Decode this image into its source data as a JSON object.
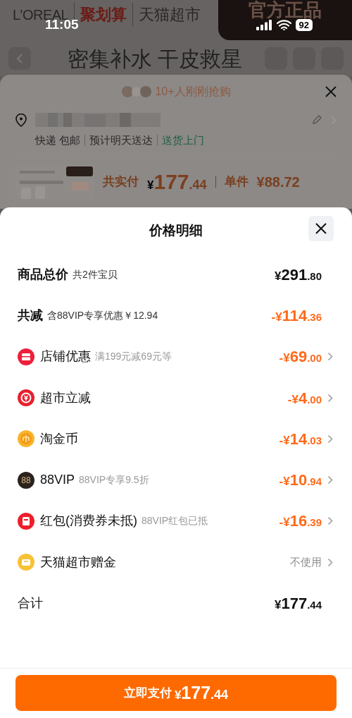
{
  "status_bar": {
    "time": "11:05",
    "battery": "92"
  },
  "banner": {
    "brand": "L'OREAL",
    "promo": "聚划算",
    "store": "天猫超市",
    "badge": "官方正品"
  },
  "page_title": "密集补水 干皮救星",
  "order_sheet": {
    "buyers": "10+人刚刚抢购",
    "shipping": [
      "快递 包邮",
      "预计明天送达"
    ],
    "delivery": "送货上门",
    "total_label": "共实付",
    "total": "¥177.44",
    "unit_label": "单件",
    "unit": "¥88.72"
  },
  "price_detail": {
    "title": "价格明细",
    "rows": [
      {
        "kind": "plain",
        "label": "商品总价",
        "bold": true,
        "note": "共2件宝贝",
        "amount": "¥291.80",
        "color": "#111111",
        "chevron": false
      },
      {
        "kind": "plain",
        "label": "共减",
        "bold": true,
        "note": "含88VIP专享优惠￥12.94",
        "amount": "-¥114.36",
        "color": "#ff6a1a",
        "chevron": false
      },
      {
        "kind": "shop",
        "label": "店铺优惠",
        "bold": false,
        "note": "满199元减69元等",
        "amount": "-¥69.00",
        "color": "#ff6a1a",
        "chevron": true
      },
      {
        "kind": "cut",
        "label": "超市立减",
        "bold": false,
        "amount": "-¥4.00",
        "color": "#ff6a1a",
        "chevron": true
      },
      {
        "kind": "coin",
        "label": "淘金币",
        "bold": false,
        "amount": "-¥14.03",
        "color": "#ff6a1a",
        "chevron": true
      },
      {
        "kind": "vip",
        "icon_label": "88",
        "label": "88VIP",
        "bold": false,
        "note": "88VIP专享9.5折",
        "amount": "-¥10.94",
        "color": "#ff6a1a",
        "chevron": true
      },
      {
        "kind": "packet",
        "label": "红包(消费券未抵)",
        "bold": false,
        "note": "88VIP红包已抵",
        "amount": "-¥16.39",
        "color": "#ff6a1a",
        "chevron": true
      },
      {
        "kind": "gift",
        "label": "天猫超市赠金",
        "bold": false,
        "amount": "不使用",
        "color": "#8b8b8b",
        "chevron": true
      },
      {
        "kind": "plain",
        "label": "合计",
        "bold": false,
        "amount": "¥177.44",
        "color": "#111111",
        "chevron": false
      }
    ]
  },
  "pay_button": {
    "label": "立即支付",
    "amount": "¥177.44"
  }
}
